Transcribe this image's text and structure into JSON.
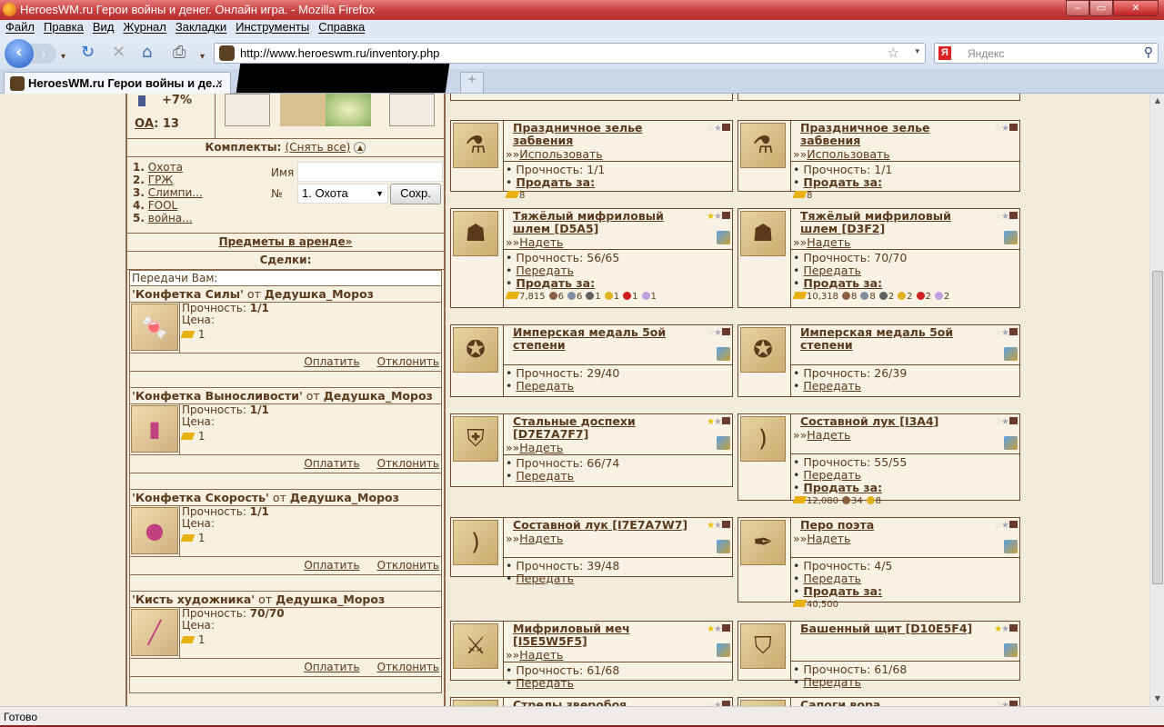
{
  "window": {
    "title": "HeroesWM.ru Герои войны и денег. Онлайн игра. - Mozilla Firefox"
  },
  "menu": [
    "Файл",
    "Правка",
    "Вид",
    "Журнал",
    "Закладки",
    "Инструменты",
    "Справка"
  ],
  "url": "http://www.heroeswm.ru/inventory.php",
  "search_placeholder": "Яндекс",
  "tab": {
    "label": "HeroesWM.ru Герои войны и де...",
    "close": "×",
    "new": "+"
  },
  "status": "Готово",
  "left": {
    "stat_bonus": "+7%",
    "oa_label": "ОА",
    "oa_value": "13",
    "sets_label": "Комплекты:",
    "remove_all": "(Снять все)",
    "sets": [
      {
        "n": "1.",
        "name": "Охота"
      },
      {
        "n": "2.",
        "name": "ГРЖ"
      },
      {
        "n": "3.",
        "name": "Слимпи..."
      },
      {
        "n": "4.",
        "name": "FOOL"
      },
      {
        "n": "5.",
        "name": "война..."
      }
    ],
    "name_label": "Имя",
    "num_label": "№",
    "num_selected": "1. Охота",
    "save_button": "Сохр.",
    "rent_link": "Предметы в аренде»",
    "deals_label": "Сделки:",
    "transfers_label": "Передачи Вам:",
    "deals": [
      {
        "item": "'Конфетка Силы'",
        "from": "от",
        "sender": "Дедушка_Мороз",
        "dur_label": "Прочность:",
        "dur": "1/1",
        "price_label": "Цена:",
        "price": "1",
        "pay": "Оплатить",
        "decline": "Отклонить",
        "icon": "candy-icon"
      },
      {
        "item": "'Конфетка Выносливости'",
        "from": "от",
        "sender": "Дедушка_Мороз",
        "dur_label": "Прочность:",
        "dur": "1/1",
        "price_label": "Цена:",
        "price": "1",
        "pay": "Оплатить",
        "decline": "Отклонить",
        "icon": "candy-green-icon"
      },
      {
        "item": "'Конфетка Скорость'",
        "from": "от",
        "sender": "Дедушка_Мороз",
        "dur_label": "Прочность:",
        "dur": "1/1",
        "price_label": "Цена:",
        "price": "1",
        "pay": "Оплатить",
        "decline": "Отклонить",
        "icon": "chocolate-icon"
      },
      {
        "item": "'Кисть художника'",
        "from": "от",
        "sender": "Дедушка_Мороз",
        "dur_label": "Прочность:",
        "dur": "70/70",
        "price_label": "Цена:",
        "price": "1",
        "pay": "Оплатить",
        "decline": "Отклонить",
        "icon": "brush-icon"
      }
    ]
  },
  "labels": {
    "use": "Использовать",
    "wear": "Надеть",
    "transfer": "Передать",
    "sell": "Продать за:",
    "dur": "Прочность:",
    "prefix": "»»"
  },
  "items": [
    {
      "title": "Праздничное зелье забвения",
      "action": "use",
      "dur": "1/1",
      "transfer": false,
      "sell": "8",
      "res": [],
      "icon": "potion-icon",
      "star": false
    },
    {
      "title": "Праздничное зелье забвения",
      "action": "use",
      "dur": "1/1",
      "transfer": false,
      "sell": "8",
      "res": [],
      "icon": "potion-icon",
      "star": false
    },
    {
      "title": "Тяжёлый мифриловый шлем [D5A5]",
      "action": "wear",
      "dur": "56/65",
      "transfer": true,
      "sell": "7,815",
      "res": [
        "6",
        "6",
        "1",
        "1",
        "1",
        "1"
      ],
      "icon": "helmet-icon",
      "star": true
    },
    {
      "title": "Тяжёлый мифриловый шлем [D3F2]",
      "action": "wear",
      "dur": "70/70",
      "transfer": true,
      "sell": "10,318",
      "res": [
        "8",
        "8",
        "2",
        "2",
        "2",
        "2"
      ],
      "icon": "helmet-icon",
      "star": false
    },
    {
      "title": "Имперская медаль 5ой степени",
      "action": null,
      "dur": "29/40",
      "transfer": true,
      "sell": null,
      "res": [],
      "icon": "medal-icon",
      "star": false
    },
    {
      "title": "Имперская медаль 5ой степени",
      "action": null,
      "dur": "26/39",
      "transfer": true,
      "sell": null,
      "res": [],
      "icon": "medal-icon",
      "star": false
    },
    {
      "title": "Стальные доспехи [D7E7A7F7]",
      "action": "wear",
      "dur": "66/74",
      "transfer": true,
      "sell": null,
      "res": [],
      "icon": "armor-icon",
      "star": true
    },
    {
      "title": "Составной лук [I3A4]",
      "action": "wear",
      "dur": "55/55",
      "transfer": true,
      "sell": "12,080",
      "res": [
        "34",
        "8"
      ],
      "icon": "bow-icon",
      "star": false
    },
    {
      "title": "Составной лук [I7E7A7W7]",
      "action": "wear",
      "dur": "39/48",
      "transfer": true,
      "sell": null,
      "res": [],
      "icon": "bow-icon",
      "star": true
    },
    {
      "title": "Перо поэта",
      "action": "wear",
      "dur": "4/5",
      "transfer": true,
      "sell": "40,500",
      "res": [],
      "icon": "feather-icon",
      "star": false
    },
    {
      "title": "Мифриловый меч [I5E5W5F5]",
      "action": "wear",
      "dur": "61/68",
      "transfer": true,
      "sell": null,
      "res": [],
      "icon": "sword-icon",
      "star": true
    },
    {
      "title": "Башенный щит [D10E5F4]",
      "action": null,
      "dur": "61/68",
      "transfer": true,
      "sell": null,
      "res": [],
      "icon": "shield-icon",
      "star": true
    },
    {
      "title": "Стрелы зверобоя",
      "action": null,
      "dur": "",
      "transfer": false,
      "sell": null,
      "res": [],
      "icon": "arrows-icon",
      "star": false
    },
    {
      "title": "Сапоги вора",
      "action": null,
      "dur": "",
      "transfer": false,
      "sell": null,
      "res": [],
      "icon": "boots-icon",
      "star": false
    }
  ],
  "colors": {
    "text": "#5a3a1a",
    "border": "#6a4a2a",
    "bg": "#f1ecdc",
    "titlebar": "#c33a3a"
  }
}
